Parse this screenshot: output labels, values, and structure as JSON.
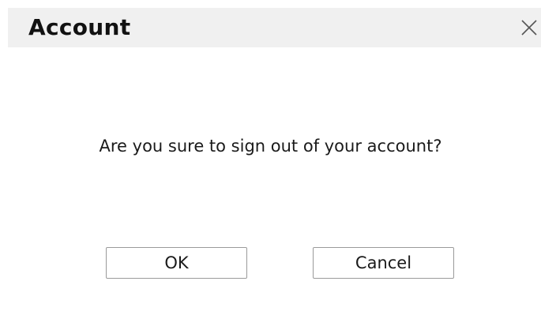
{
  "dialog": {
    "title": "Account",
    "close_icon": "close-icon",
    "message": "Are you sure to sign out of your account?",
    "buttons": {
      "ok_label": "OK",
      "cancel_label": "Cancel"
    }
  }
}
